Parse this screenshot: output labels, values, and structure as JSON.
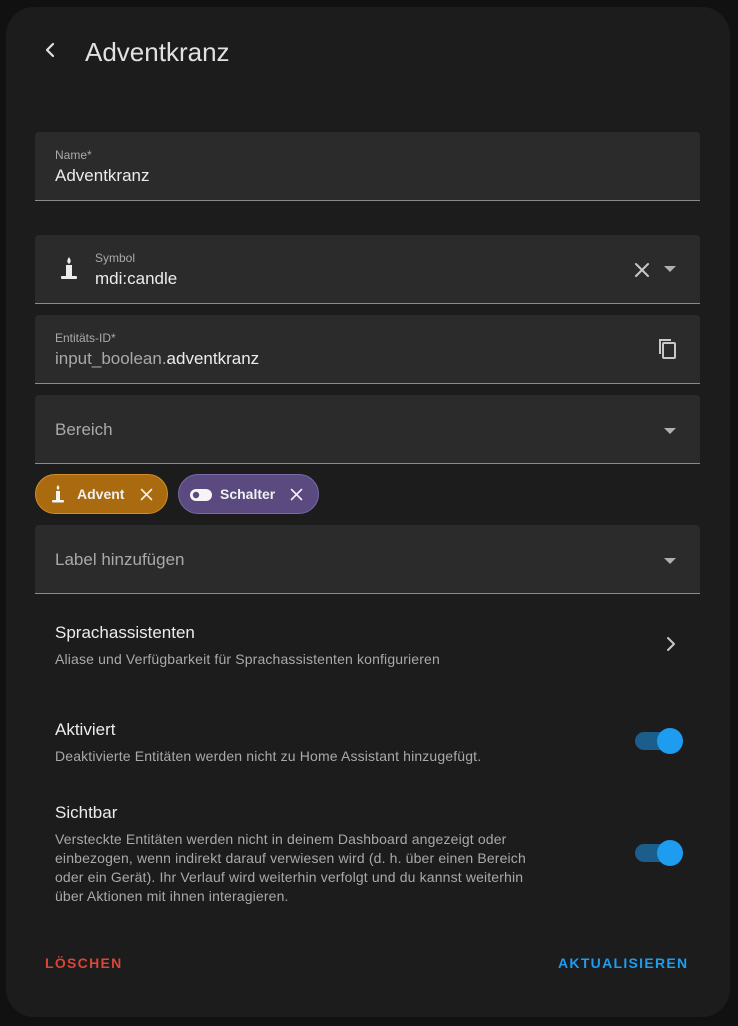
{
  "dialog": {
    "title": "Adventkranz"
  },
  "fields": {
    "name": {
      "label": "Name*",
      "value": "Adventkranz"
    },
    "icon": {
      "label": "Symbol",
      "value": "mdi:candle"
    },
    "entity_id": {
      "label": "Entitäts-ID*",
      "prefix": "input_boolean.",
      "value": "adventkranz"
    },
    "area": {
      "placeholder": "Bereich"
    },
    "labels": {
      "placeholder": "Label hinzufügen"
    }
  },
  "chips": [
    {
      "label": "Advent",
      "color": "#a96a10",
      "icon": "candle-icon"
    },
    {
      "label": "Schalter",
      "color": "#5a4a80",
      "icon": "toggle-switch-icon"
    }
  ],
  "voice": {
    "title": "Sprachassistenten",
    "subtitle": "Aliase und Verfügbarkeit für Sprachassistenten konfigurieren"
  },
  "enabled": {
    "title": "Aktiviert",
    "subtitle": "Deaktivierte Entitäten werden nicht zu Home Assistant hinzugefügt.",
    "on": true
  },
  "visible": {
    "title": "Sichtbar",
    "subtitle_lines": [
      "Versteckte Entitäten werden nicht in deinem Dashboard angezeigt oder",
      "einbezogen, wenn indirekt darauf verwiesen wird (d. h. über einen Bereich",
      "oder ein Gerät). Ihr Verlauf wird weiterhin verfolgt und du kannst weiterhin",
      "über Aktionen mit ihnen interagieren."
    ],
    "on": true
  },
  "actions": {
    "delete": "LÖSCHEN",
    "update": "AKTUALISIEREN"
  },
  "colors": {
    "accent": "#1e9cef",
    "danger": "#db4437"
  }
}
